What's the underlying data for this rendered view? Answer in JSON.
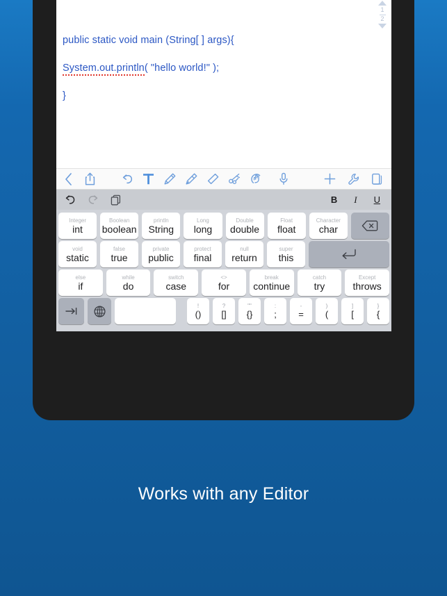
{
  "caption": {
    "text": "Works with any Editor"
  },
  "note": {
    "lines": [
      {
        "text": "public static void main (String[ ] args){",
        "spell_error": ""
      },
      {
        "text": "( \"hello world!\" );",
        "spell_error": "System.out.println"
      },
      {
        "text": "}",
        "spell_error": ""
      }
    ],
    "pager": {
      "current": "1",
      "total": "2"
    }
  },
  "toolbar": {
    "left": [
      {
        "name": "back-icon",
        "label": "Back"
      },
      {
        "name": "share-icon",
        "label": "Share"
      }
    ],
    "undo": {
      "name": "undo-icon",
      "label": "Undo"
    },
    "center": [
      {
        "name": "text-tool-icon",
        "label": "Text"
      },
      {
        "name": "pen-tool-icon",
        "label": "Pen"
      },
      {
        "name": "highlighter-tool-icon",
        "label": "Highlighter"
      },
      {
        "name": "eraser-tool-icon",
        "label": "Eraser"
      },
      {
        "name": "lasso-cut-tool-icon",
        "label": "Cut"
      },
      {
        "name": "hand-tool-icon",
        "label": "Hand"
      }
    ],
    "mic": {
      "name": "microphone-icon",
      "label": "Dictate"
    },
    "right": [
      {
        "name": "plus-icon",
        "label": "Add"
      },
      {
        "name": "wrench-icon",
        "label": "Settings"
      },
      {
        "name": "pages-icon",
        "label": "Pages"
      }
    ]
  },
  "format_bar": {
    "left": [
      {
        "name": "undo-icon",
        "label": "Undo",
        "enabled": true
      },
      {
        "name": "redo-icon",
        "label": "Redo",
        "enabled": false
      },
      {
        "name": "copy-icon",
        "label": "Copy",
        "enabled": true
      }
    ],
    "bold": "B",
    "italic": "I",
    "underline": "U"
  },
  "keyboard": {
    "row1": [
      {
        "sub": "Integer",
        "main": "int"
      },
      {
        "sub": "Boolean",
        "main": "boolean"
      },
      {
        "sub": "println",
        "main": "String"
      },
      {
        "sub": "Long",
        "main": "long"
      },
      {
        "sub": "Double",
        "main": "double"
      },
      {
        "sub": "Float",
        "main": "float"
      },
      {
        "sub": "Character",
        "main": "char"
      }
    ],
    "row1_action": {
      "name": "backspace-key",
      "glyph": "⌫"
    },
    "row2": [
      {
        "sub": "void",
        "main": "static"
      },
      {
        "sub": "false",
        "main": "true"
      },
      {
        "sub": "private",
        "main": "public"
      },
      {
        "sub": "protect",
        "main": "final"
      },
      {
        "sub": "null",
        "main": "return"
      },
      {
        "sub": "super",
        "main": "this"
      }
    ],
    "row2_action": {
      "name": "return-key",
      "glyph": "↵"
    },
    "row3": [
      {
        "sub": "else",
        "main": "if"
      },
      {
        "sub": "while",
        "main": "do"
      },
      {
        "sub": "switch",
        "main": "case"
      },
      {
        "sub": "<>",
        "main": "for"
      },
      {
        "sub": "break",
        "main": "continue"
      },
      {
        "sub": "catch",
        "main": "try"
      },
      {
        "sub": "Except",
        "main": "throws"
      }
    ],
    "row4": {
      "tab": {
        "name": "tab-key",
        "glyph": "⇥"
      },
      "globe": {
        "name": "globe-key",
        "glyph": "ἱ0"
      },
      "space": {
        "main": ""
      },
      "symbols": [
        {
          "sub": "!",
          "main": "()"
        },
        {
          "sub": "?",
          "main": "[]"
        },
        {
          "sub": "\"\"",
          "main": "{}"
        },
        {
          "sub": ":",
          "main": ";"
        },
        {
          "sub": "-",
          "main": "="
        },
        {
          "sub": ")",
          "main": "("
        },
        {
          "sub": "]",
          "main": "["
        },
        {
          "sub": "}",
          "main": "{"
        }
      ]
    }
  },
  "colors": {
    "background": "#1468b0",
    "bezel": "#1e1e1e",
    "code_text": "#2b57c4",
    "spell_underline": "#e0352b",
    "tool_icon": "#7aa7dd",
    "keyboard_bg": "#d1d4da",
    "key_bg": "#ffffff",
    "key_gray": "#abb0ba"
  }
}
